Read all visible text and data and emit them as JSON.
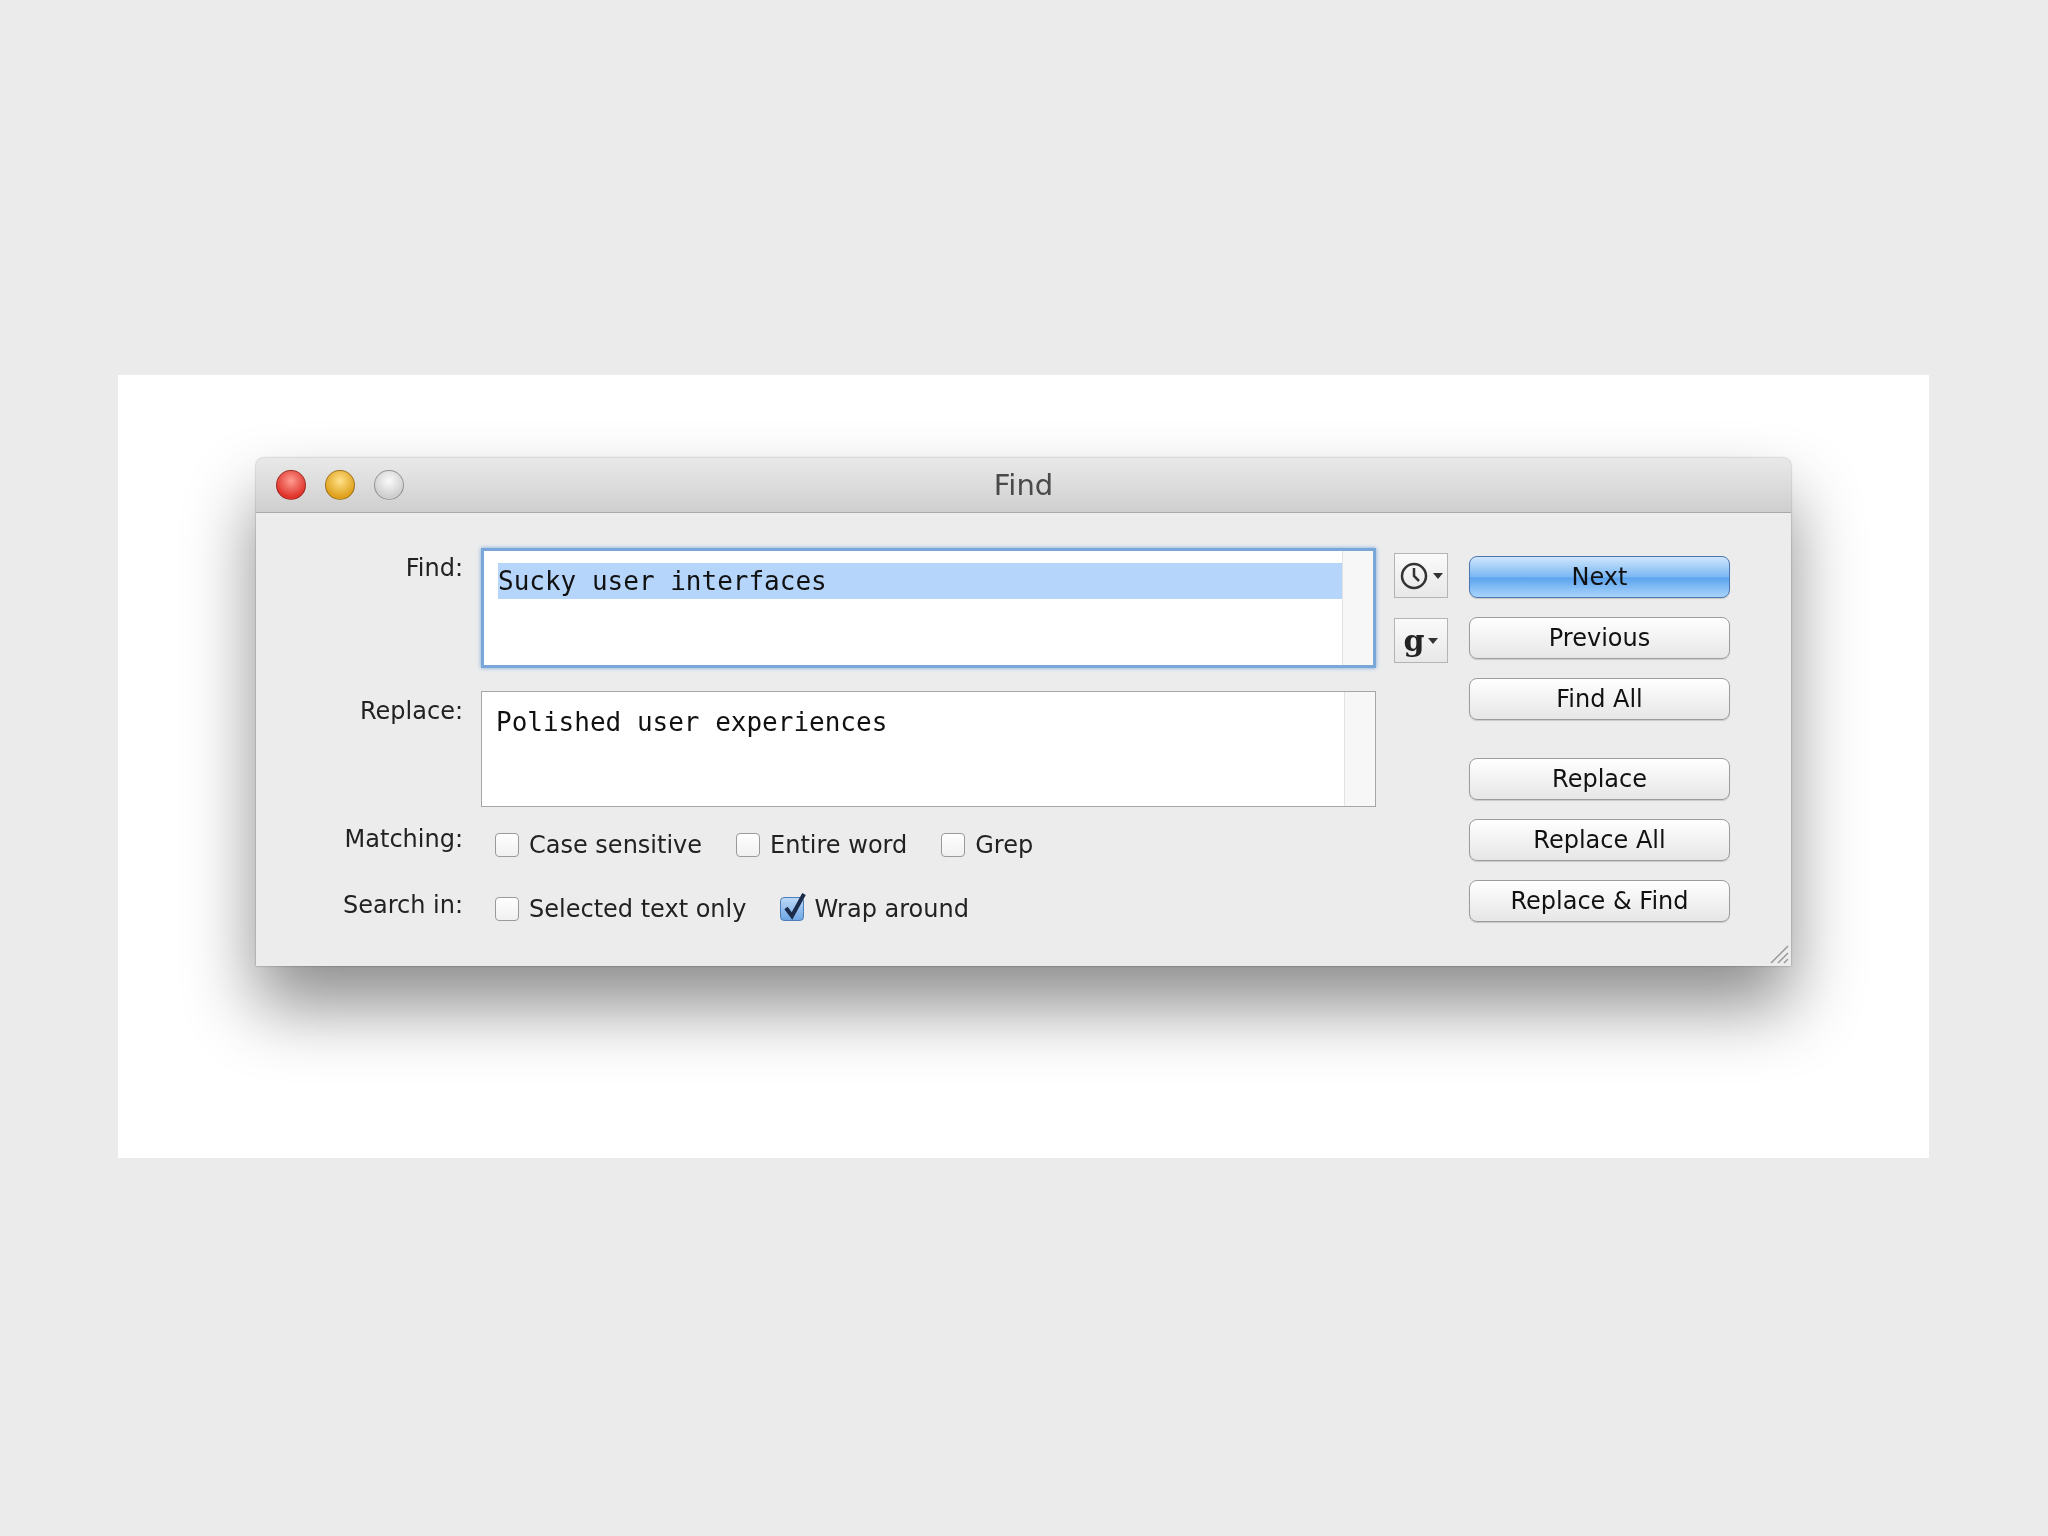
{
  "window": {
    "title": "Find"
  },
  "find": {
    "label": "Find:",
    "value": "Sucky user interfaces",
    "text_selected": true,
    "focused": true
  },
  "replace": {
    "label": "Replace:",
    "value": "Polished user experiences",
    "focused": false
  },
  "side_buttons": [
    {
      "kind": "history"
    },
    {
      "kind": "grep",
      "text": "g"
    }
  ],
  "options": [
    {
      "label": "Matching:",
      "checkboxes": [
        {
          "label": "Case sensitive",
          "checked": false
        },
        {
          "label": "Entire word",
          "checked": false
        },
        {
          "label": "Grep",
          "checked": false
        }
      ]
    },
    {
      "label": "Search in:",
      "checkboxes": [
        {
          "label": "Selected text only",
          "checked": false
        },
        {
          "label": "Wrap around",
          "checked": true
        }
      ]
    }
  ],
  "find_buttons": [
    {
      "label": "Next",
      "default": true
    },
    {
      "label": "Previous",
      "default": false
    },
    {
      "label": "Find All",
      "default": false
    }
  ],
  "replace_buttons": [
    {
      "label": "Replace",
      "default": false
    },
    {
      "label": "Replace All",
      "default": false
    },
    {
      "label": "Replace & Find",
      "default": false
    }
  ]
}
